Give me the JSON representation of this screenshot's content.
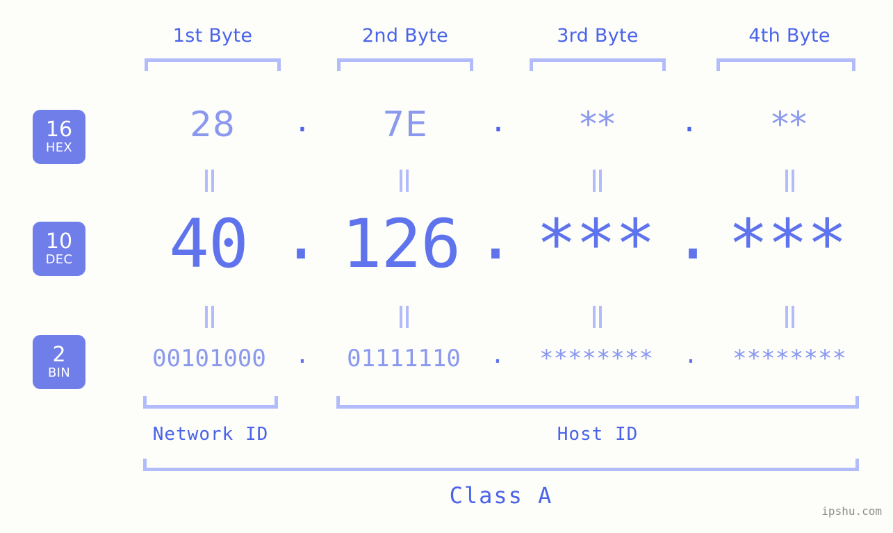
{
  "meta": {
    "watermark": "ipshu.com",
    "background_color": "#fdfdfa",
    "accent_color": "#4a63e8",
    "badge_color": "#6f7ee8",
    "light_accent_color": "#b3bcfa",
    "value_color": "#8a98ee",
    "dec_color": "#5f74ec"
  },
  "byte_headers": [
    {
      "label": "1st Byte"
    },
    {
      "label": "2nd Byte"
    },
    {
      "label": "3rd Byte"
    },
    {
      "label": "4th Byte"
    }
  ],
  "rows": [
    {
      "badge_num": "16",
      "badge_name": "HEX",
      "values": [
        "28",
        "7E",
        "**",
        "**"
      ],
      "separator": "."
    },
    {
      "badge_num": "10",
      "badge_name": "DEC",
      "values": [
        "40",
        "126",
        "***",
        "***"
      ],
      "separator": "."
    },
    {
      "badge_num": "2",
      "badge_name": "BIN",
      "values": [
        "00101000",
        "01111110",
        "********",
        "********"
      ],
      "separator": "."
    }
  ],
  "equals_symbol": "=",
  "segments": {
    "network_id": "Network ID",
    "host_id": "Host ID"
  },
  "class_label": "Class A"
}
